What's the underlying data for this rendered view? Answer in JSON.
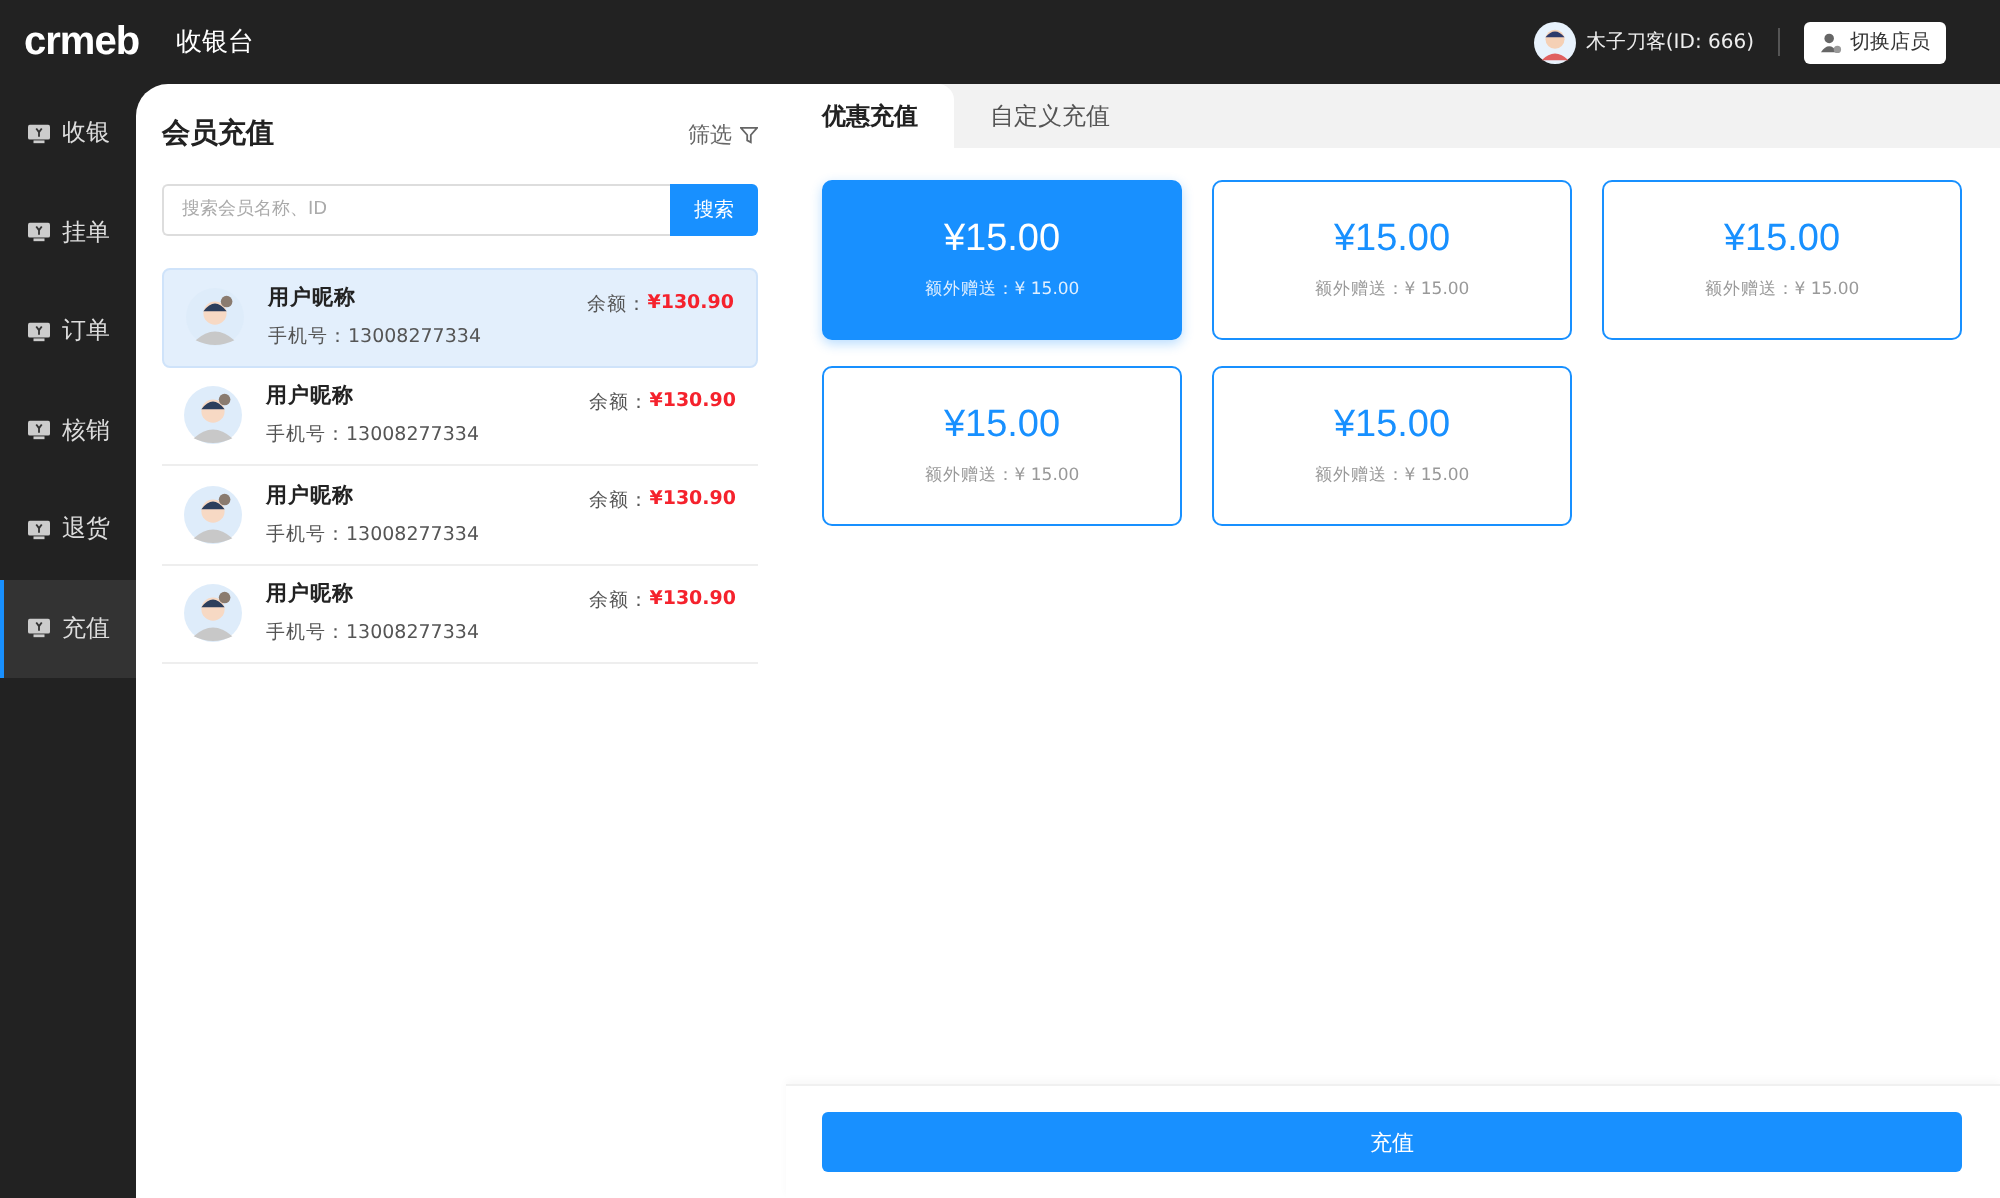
{
  "header": {
    "logo": "crmeb",
    "title": "收银台",
    "user": "木子刀客(ID: 666)",
    "switch_button": "切换店员"
  },
  "sidebar": {
    "items": [
      {
        "label": "收银",
        "selected": false
      },
      {
        "label": "挂单",
        "selected": false
      },
      {
        "label": "订单",
        "selected": false
      },
      {
        "label": "核销",
        "selected": false
      },
      {
        "label": "退货",
        "selected": false
      },
      {
        "label": "充值",
        "selected": true
      }
    ]
  },
  "members_panel": {
    "title": "会员充值",
    "filter": "筛选",
    "search": {
      "placeholder": "搜索会员名称、ID",
      "button": "搜索"
    },
    "members": [
      {
        "name": "用户昵称",
        "phone": "手机号：13008277334",
        "balance_label": "余额：",
        "balance": "¥130.90",
        "selected": true
      },
      {
        "name": "用户昵称",
        "phone": "手机号：13008277334",
        "balance_label": "余额：",
        "balance": "¥130.90",
        "selected": false
      },
      {
        "name": "用户昵称",
        "phone": "手机号：13008277334",
        "balance_label": "余额：",
        "balance": "¥130.90",
        "selected": false
      },
      {
        "name": "用户昵称",
        "phone": "手机号：13008277334",
        "balance_label": "余额：",
        "balance": "¥130.90",
        "selected": false
      }
    ]
  },
  "recharge": {
    "tabs": [
      {
        "label": "优惠充值",
        "selected": true
      },
      {
        "label": "自定义充值",
        "selected": false
      }
    ],
    "options": [
      {
        "amount": "¥15.00",
        "bonus": "额外赠送：¥ 15.00",
        "selected": true
      },
      {
        "amount": "¥15.00",
        "bonus": "额外赠送：¥ 15.00",
        "selected": false
      },
      {
        "amount": "¥15.00",
        "bonus": "额外赠送：¥ 15.00",
        "selected": false
      },
      {
        "amount": "¥15.00",
        "bonus": "额外赠送：¥ 15.00",
        "selected": false
      },
      {
        "amount": "¥15.00",
        "bonus": "额外赠送：¥ 15.00",
        "selected": false
      }
    ],
    "submit": "充值"
  }
}
